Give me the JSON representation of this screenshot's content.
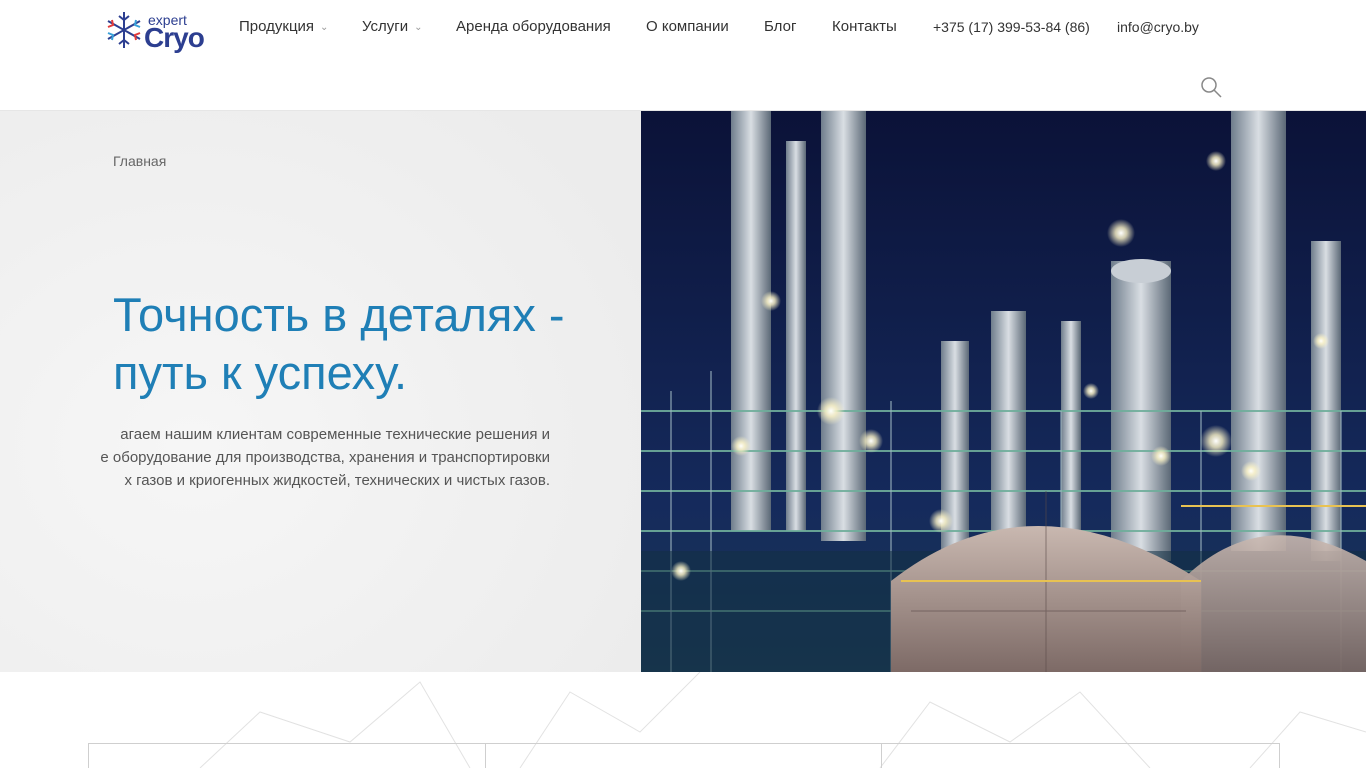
{
  "header": {
    "logo": {
      "top": "expert",
      "main": "Cryo"
    },
    "nav": [
      {
        "label": "Продукция",
        "has_dropdown": true
      },
      {
        "label": "Услуги",
        "has_dropdown": true
      },
      {
        "label": "Аренда оборудования",
        "has_dropdown": false
      },
      {
        "label": "О компании",
        "has_dropdown": false
      },
      {
        "label": "Блог",
        "has_dropdown": false
      },
      {
        "label": "Контакты",
        "has_dropdown": false
      }
    ],
    "phone": "+375 (17) 399-53-84 (86)",
    "email": "info@cryo.by",
    "search_icon": "search-icon"
  },
  "hero": {
    "breadcrumb": "Главная",
    "title_line1": "Точность в деталях -",
    "title_line2": "путь к успеху.",
    "text_line1": "агаем нашим клиентам современные технические решения и",
    "text_line2": "е оборудование для производства, хранения и транспортировки",
    "text_line3": "х газов и криогенных жидкостей, технических и чистых газов.",
    "image_alt": "refinery-night-photo"
  },
  "colors": {
    "accent": "#1f7fb6",
    "logo": "#2c3e90",
    "logo_red": "#e23b3b",
    "hero_bg": "#f1f1f1",
    "night_sky": "#0d1640"
  }
}
